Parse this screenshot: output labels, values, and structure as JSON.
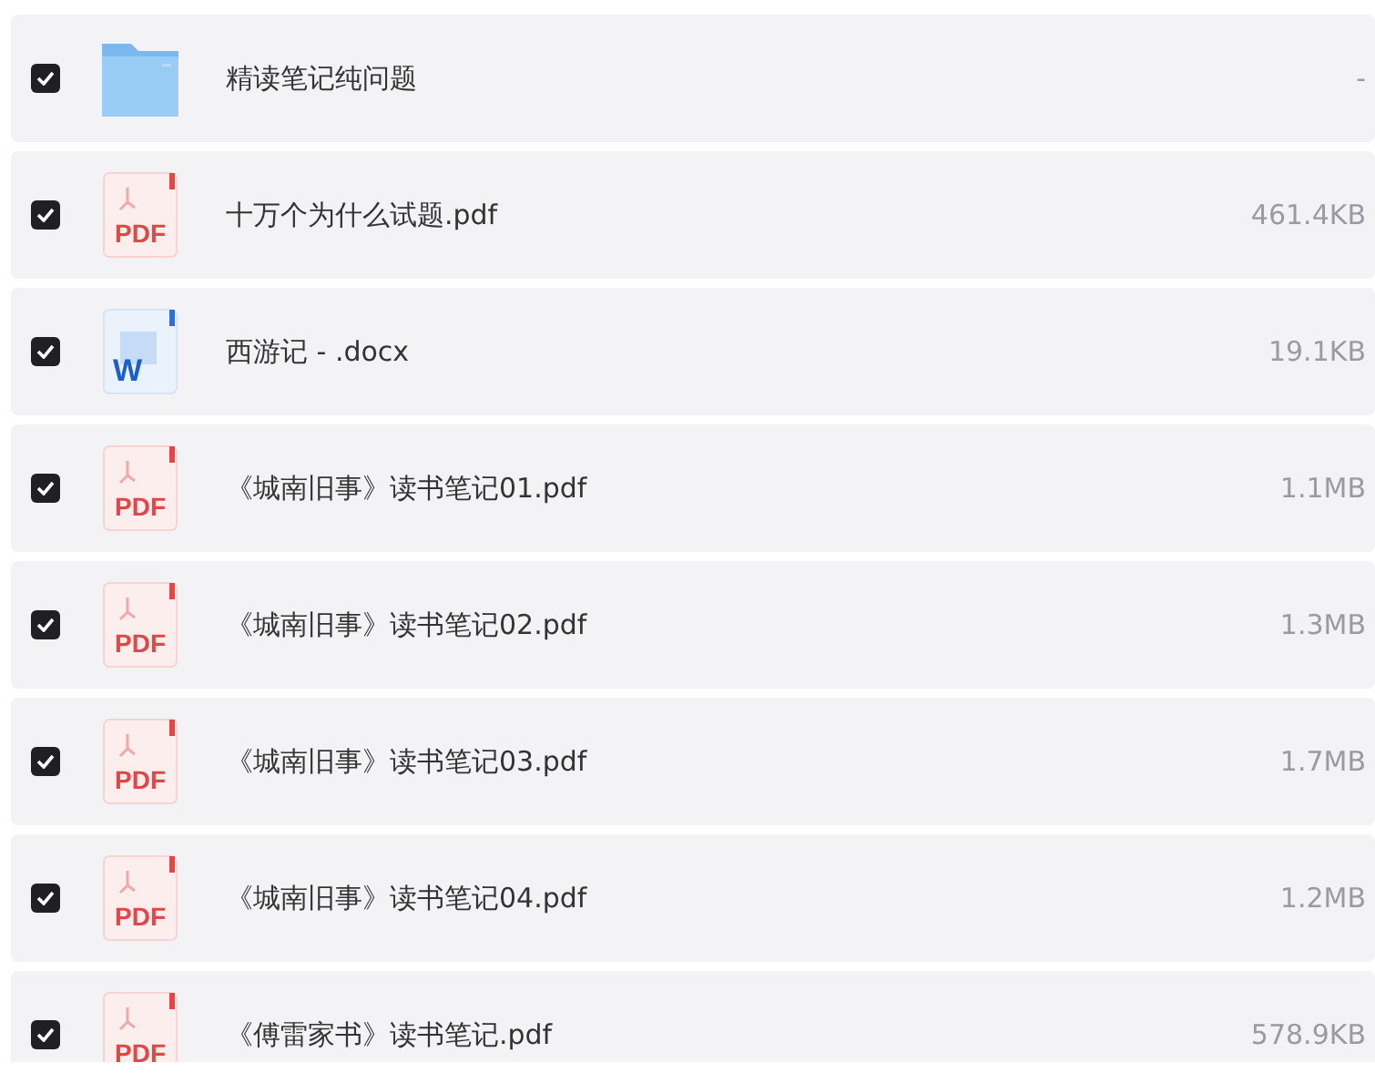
{
  "files": [
    {
      "kind": "folder",
      "name": "精读笔记纯问题",
      "size": "-",
      "checked": true
    },
    {
      "kind": "pdf",
      "badge": "PDF",
      "name": "十万个为什么试题.pdf",
      "size": "461.4KB",
      "checked": true
    },
    {
      "kind": "word",
      "badge": "W",
      "name": "西游记 - .docx",
      "size": "19.1KB",
      "checked": true
    },
    {
      "kind": "pdf",
      "badge": "PDF",
      "name": "《城南旧事》读书笔记01.pdf",
      "size": "1.1MB",
      "checked": true
    },
    {
      "kind": "pdf",
      "badge": "PDF",
      "name": "《城南旧事》读书笔记02.pdf",
      "size": "1.3MB",
      "checked": true
    },
    {
      "kind": "pdf",
      "badge": "PDF",
      "name": "《城南旧事》读书笔记03.pdf",
      "size": "1.7MB",
      "checked": true
    },
    {
      "kind": "pdf",
      "badge": "PDF",
      "name": "《城南旧事》读书笔记04.pdf",
      "size": "1.2MB",
      "checked": true
    },
    {
      "kind": "pdf",
      "badge": "PDF",
      "name": "《傅雷家书》读书笔记.pdf",
      "size": "578.9KB",
      "checked": true
    }
  ]
}
